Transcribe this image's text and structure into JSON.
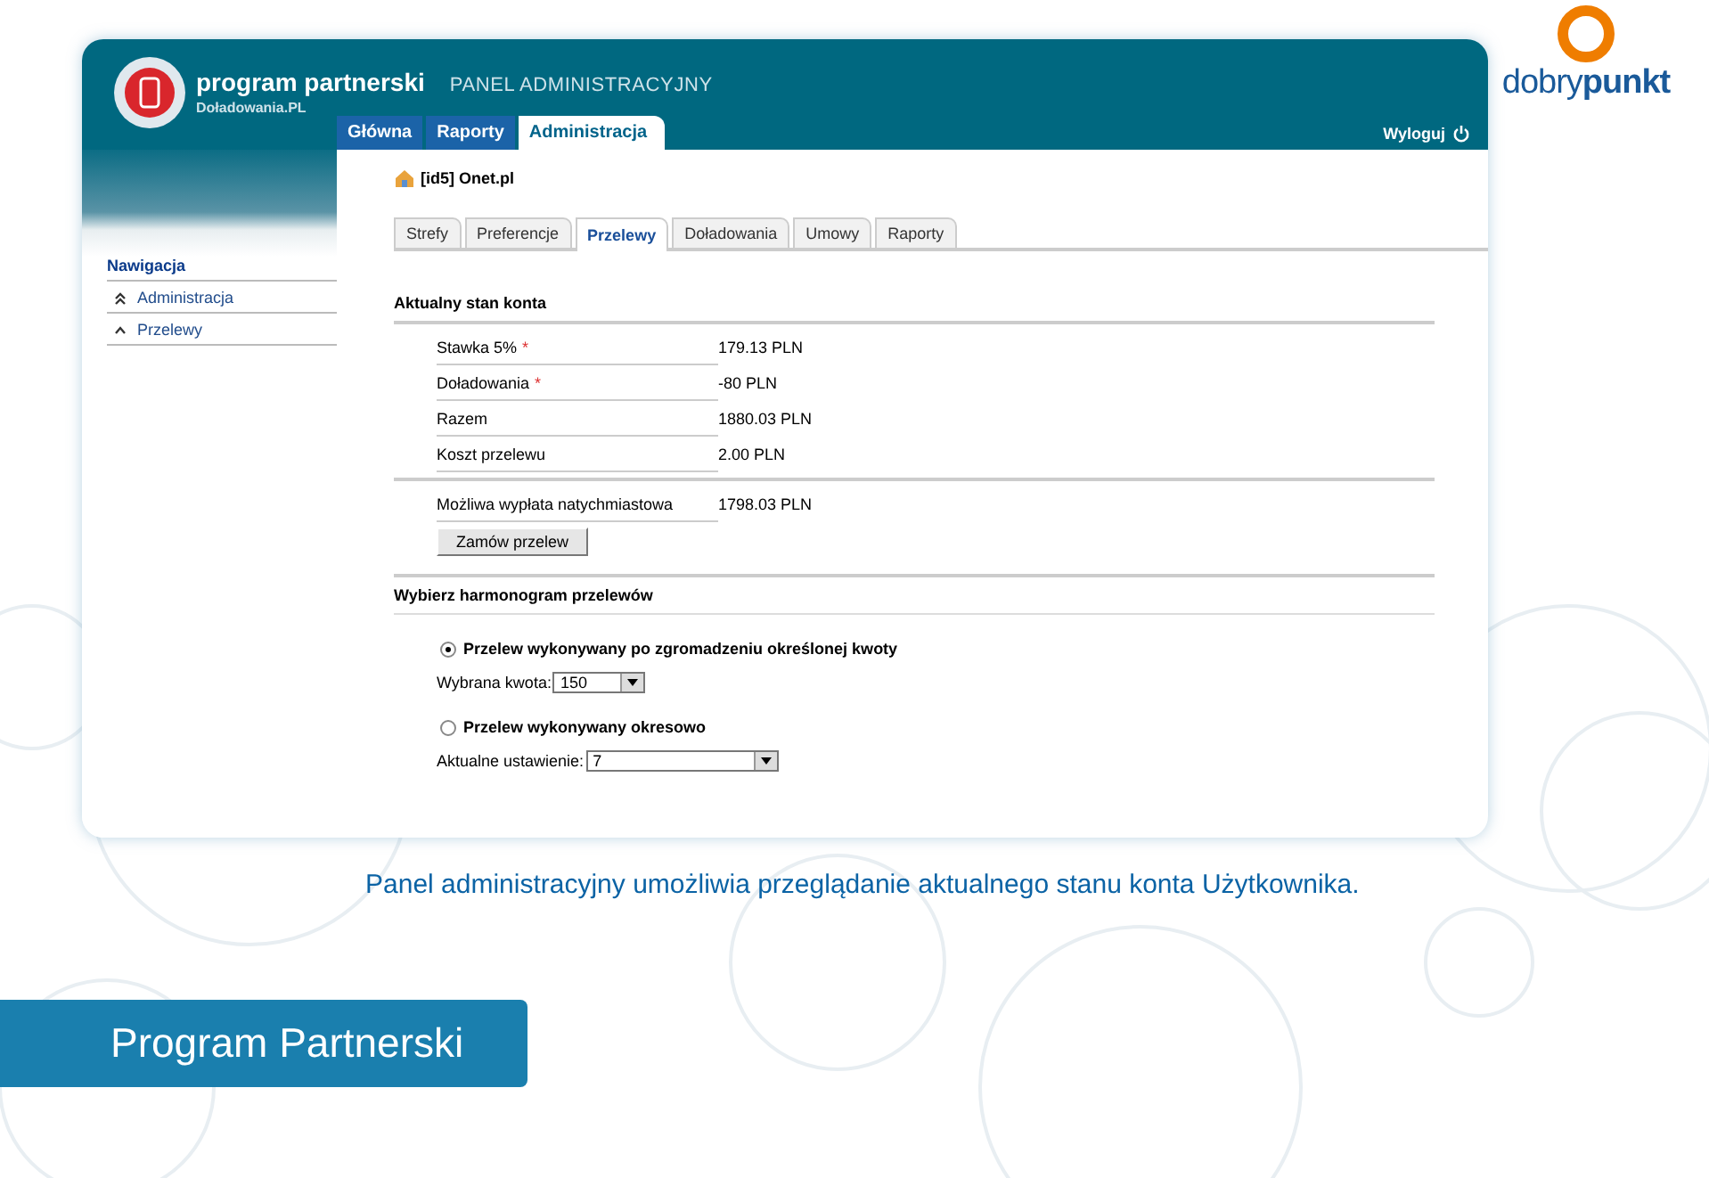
{
  "app_header": {
    "title": "program partnerski",
    "subtitle": "Doładowania.PL",
    "panel_label": "PANEL ADMINISTRACYJNY",
    "logout": "Wyloguj"
  },
  "main_tabs": [
    {
      "label": "Główna",
      "selected": false
    },
    {
      "label": "Raporty",
      "selected": false
    },
    {
      "label": "Administracja",
      "selected": true
    }
  ],
  "sidebar": {
    "heading": "Nawigacja",
    "items": [
      {
        "label": "Administracja",
        "kind": "double"
      },
      {
        "label": "Przelewy",
        "kind": "single"
      }
    ]
  },
  "page_title": "[id5] Onet.pl",
  "sub_tabs": [
    {
      "label": "Strefy",
      "selected": false
    },
    {
      "label": "Preferencje",
      "selected": false
    },
    {
      "label": "Przelewy",
      "selected": true
    },
    {
      "label": "Doładowania",
      "selected": false
    },
    {
      "label": "Umowy",
      "selected": false
    },
    {
      "label": "Raporty",
      "selected": false
    }
  ],
  "account": {
    "heading": "Aktualny stan konta",
    "rows": [
      {
        "label": "Stawka 5%",
        "required_mark": "*",
        "value": "179.13 PLN"
      },
      {
        "label": "Doładowania",
        "required_mark": "*",
        "value": "-80 PLN"
      },
      {
        "label": "Razem",
        "value": "1880.03 PLN"
      },
      {
        "label": "Koszt przelewu",
        "value": "2.00 PLN"
      }
    ],
    "payout": {
      "label": "Możliwa wypłata natychmiastowa",
      "value": "1798.03 PLN"
    },
    "order_button": "Zamów przelew"
  },
  "schedule": {
    "heading": "Wybierz harmonogram przelewów",
    "options": [
      {
        "label": "Przelew wykonywany po zgromadzeniu określonej kwoty",
        "selected": true,
        "field_label": "Wybrana kwota:",
        "field_value": "150",
        "kind": "short"
      },
      {
        "label": "Przelew wykonywany okresowo",
        "selected": false,
        "field_label": "Aktualne ustawienie:",
        "field_value": "7",
        "kind": "long"
      }
    ]
  },
  "brand_logo": {
    "light": "dobry",
    "bold": "punkt"
  },
  "caption": "Panel administracyjny umożliwia przeglądanie aktualnego stanu konta Użytkownika.",
  "footer_band": "Program Partnerski"
}
